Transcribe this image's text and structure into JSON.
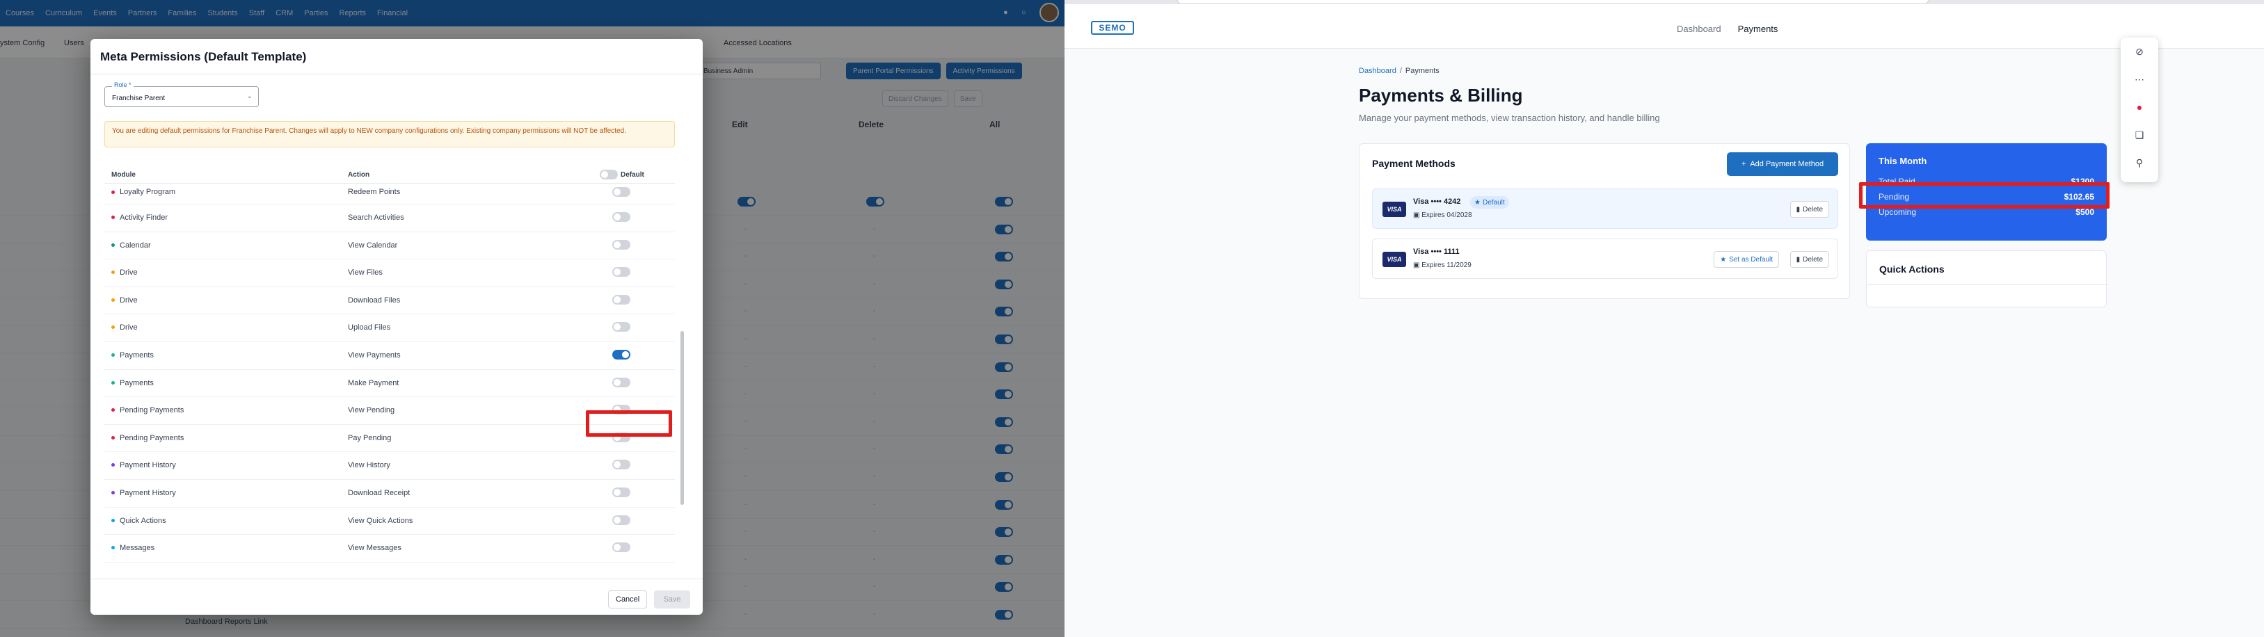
{
  "left_app": {
    "nav": [
      "Courses",
      "Curriculum",
      "Events",
      "Partners",
      "Families",
      "Students",
      "Staff",
      "CRM",
      "Parties",
      "Reports",
      "Financial"
    ],
    "tabs": [
      "ystem Config",
      "Users",
      "Accessed Locations"
    ],
    "role_select": "Business Admin",
    "btn_parent_portal": "Parent Portal Permissions",
    "btn_activity": "Activity Permissions",
    "btn_discard": "Discard Changes",
    "btn_save_bg": "Save",
    "col_edit": "Edit",
    "col_delete": "Delete",
    "col_all": "All",
    "bg_row_label": "Dashboard Reports Link",
    "dash": "-"
  },
  "modal": {
    "title": "Meta Permissions (Default Template)",
    "role_label": "Role *",
    "role_value": "Franchise Parent",
    "warning": "You are editing default permissions for Franchise Parent. Changes will apply to NEW company configurations only. Existing company permissions will NOT be affected.",
    "col_module": "Module",
    "col_action": "Action",
    "col_default": "Default",
    "rows": [
      {
        "module": "Loyalty Program",
        "action": "Redeem Points",
        "color": "#e11d48",
        "on": false
      },
      {
        "module": "Activity Finder",
        "action": "Search Activities",
        "color": "#e11d48",
        "on": false
      },
      {
        "module": "Calendar",
        "action": "View Calendar",
        "color": "#0d9488",
        "on": false
      },
      {
        "module": "Drive",
        "action": "View Files",
        "color": "#f59e0b",
        "on": false
      },
      {
        "module": "Drive",
        "action": "Download Files",
        "color": "#f59e0b",
        "on": false
      },
      {
        "module": "Drive",
        "action": "Upload Files",
        "color": "#f59e0b",
        "on": false
      },
      {
        "module": "Payments",
        "action": "View Payments",
        "color": "#10b981",
        "on": true
      },
      {
        "module": "Payments",
        "action": "Make Payment",
        "color": "#10b981",
        "on": false
      },
      {
        "module": "Pending Payments",
        "action": "View Pending",
        "color": "#e11d48",
        "on": false
      },
      {
        "module": "Pending Payments",
        "action": "Pay Pending",
        "color": "#e11d48",
        "on": false
      },
      {
        "module": "Payment History",
        "action": "View History",
        "color": "#7c3aed",
        "on": false
      },
      {
        "module": "Payment History",
        "action": "Download Receipt",
        "color": "#7c3aed",
        "on": false
      },
      {
        "module": "Quick Actions",
        "action": "View Quick Actions",
        "color": "#0ea5e9",
        "on": false
      },
      {
        "module": "Messages",
        "action": "View Messages",
        "color": "#0ea5e9",
        "on": false
      }
    ],
    "cancel": "Cancel",
    "save": "Save"
  },
  "right_app": {
    "logo": "SEMO",
    "nav": [
      "Dashboard",
      "Payments"
    ],
    "breadcrumb_home": "Dashboard",
    "breadcrumb_sep": "/",
    "breadcrumb_current": "Payments",
    "title": "Payments & Billing",
    "subtitle": "Manage your payment methods, view transaction history, and handle billing",
    "payment_methods_title": "Payment Methods",
    "add_payment_method": "Add Payment Method",
    "cards": [
      {
        "brand": "VISA",
        "name": "Visa •••• 4242",
        "expires": "Expires 04/2028",
        "default_badge": "Default",
        "is_default": true,
        "delete": "Delete"
      },
      {
        "brand": "VISA",
        "name": "Visa •••• 1111",
        "expires": "Expires 11/2029",
        "set_default": "Set as Default",
        "is_default": false,
        "delete": "Delete"
      }
    ],
    "this_month": {
      "title": "This Month",
      "total_paid_label": "Total Paid",
      "total_paid": "$1300",
      "pending_label": "Pending",
      "pending": "$102.65",
      "upcoming_label": "Upcoming",
      "upcoming": "$500"
    },
    "quick_actions_title": "Quick Actions",
    "float_icons": [
      "eye-off-icon",
      "more-icon",
      "color-wheel-icon",
      "copy-icon",
      "search-icon"
    ]
  },
  "colors": {
    "brand_blue": "#1e6fc0",
    "highlight_red": "#e11d1d",
    "card_blue": "#2563eb"
  }
}
